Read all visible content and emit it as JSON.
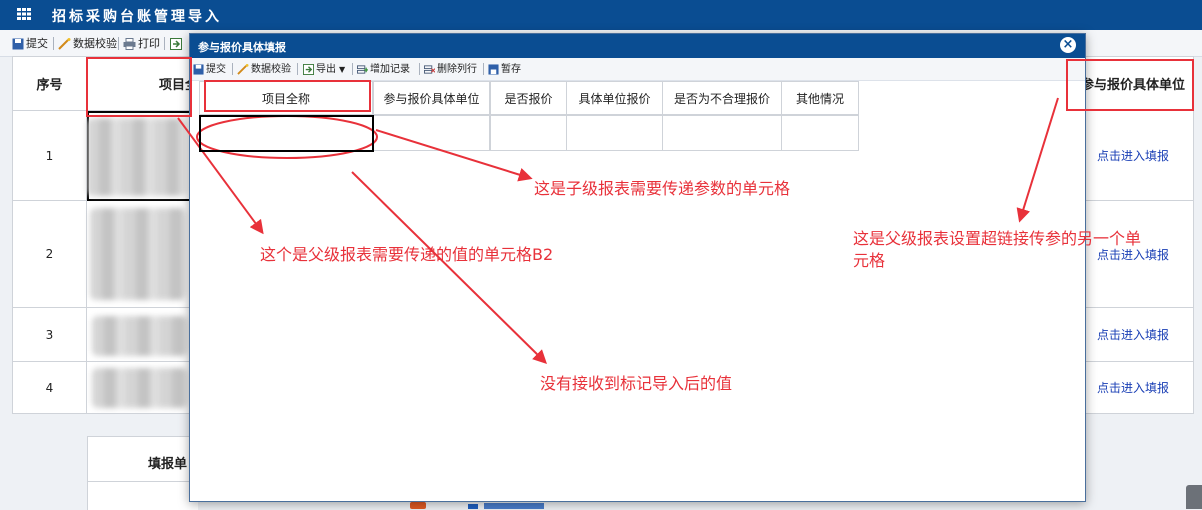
{
  "window": {
    "title": "招标采购台账管理导入"
  },
  "parent_toolbar": {
    "submit": "提交",
    "validate": "数据校验",
    "print": "打印"
  },
  "parent_table": {
    "headers": {
      "seq": "序号",
      "project_name": "项目全",
      "unit": "参与报价具体单位"
    },
    "rows": [
      {
        "seq": "1",
        "link": "点击进入填报"
      },
      {
        "seq": "2",
        "link": "点击进入填报"
      },
      {
        "seq": "3",
        "link": "点击进入填报"
      },
      {
        "seq": "4",
        "link": "点击进入填报"
      }
    ],
    "footer_label": "填报单"
  },
  "dialog": {
    "title": "参与报价具体填报",
    "close_icon": "×",
    "toolbar": {
      "submit": "提交",
      "validate": "数据校验",
      "export": "导出",
      "add_record": "增加记录",
      "delete_row": "删除列行",
      "save_draft": "暂存"
    },
    "table": {
      "headers": [
        "项目全称",
        "参与报价具体单位",
        "是否报价",
        "具体单位报价",
        "是否为不合理报价",
        "其他情况"
      ]
    }
  },
  "annotations": {
    "child_cell": "这是子级报表需要传递参数的单元格",
    "parent_cell_b2": "这个是父级报表需要传递的值的单元格B2",
    "not_received": "没有接收到标记导入后的值",
    "hyperlink_cell_line1": "这是父级报表设置超链接传参的另一个单",
    "hyperlink_cell_line2": "元格",
    "color": "#e8313a"
  },
  "colors": {
    "title_bar": "#0a4d92",
    "link": "#1a3fb5"
  }
}
